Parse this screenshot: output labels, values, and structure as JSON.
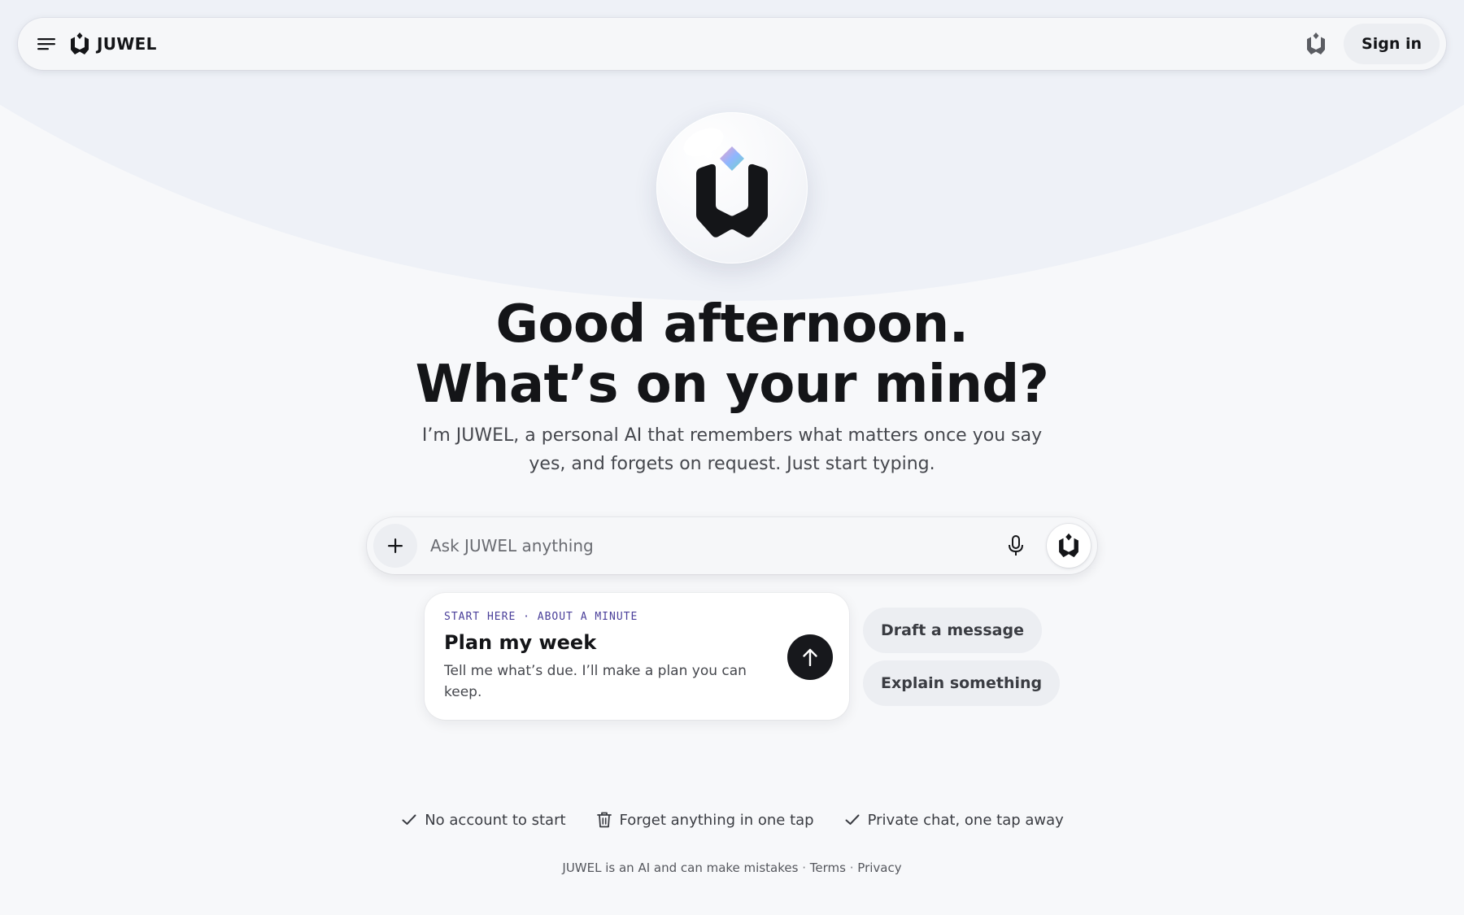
{
  "header": {
    "brand_name": "JUWEL",
    "signin_label": "Sign in",
    "icons": {
      "menu": "hamburger-icon",
      "brand": "juwel-logo-icon",
      "gem": "gem-icon"
    }
  },
  "hero": {
    "headline_line1": "Good afternoon.",
    "headline_line2": "What’s on your mind?",
    "subtext": "I’m JUWEL, a personal AI that remembers what matters once you say yes, and forgets on request. Just start typing."
  },
  "composer": {
    "placeholder": "Ask JUWEL anything",
    "value": "",
    "icons": {
      "attach": "plus-icon",
      "mic": "microphone-icon",
      "send": "juwel-gem-icon"
    }
  },
  "suggestion_card": {
    "eyebrow": "START HERE · ABOUT A MINUTE",
    "title": "Plan my week",
    "description": "Tell me what’s due. I’ll make a plan you can keep.",
    "action_icon": "arrow-up-icon"
  },
  "chips": [
    {
      "label": "Draft a message"
    },
    {
      "label": "Explain something"
    }
  ],
  "features": [
    {
      "icon": "check-icon",
      "label": "No account to start"
    },
    {
      "icon": "trash-icon",
      "label": "Forget anything in one tap"
    },
    {
      "icon": "check-icon",
      "label": "Private chat, one tap away"
    }
  ],
  "footer": {
    "disclaimer": "JUWEL is an AI and can make mistakes",
    "separator": "·",
    "terms": "Terms",
    "privacy": "Privacy"
  },
  "colors": {
    "background": "#f7f8fa",
    "hero_tint": "#eef1f7",
    "text_primary": "#141518",
    "eyebrow": "#4a3f9a",
    "dark_button": "#17181c",
    "chip_bg": "#eceef2"
  }
}
